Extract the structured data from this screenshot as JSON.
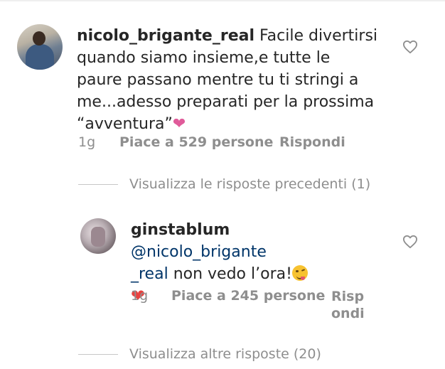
{
  "comment": {
    "username": "nicolo_brigante_real",
    "line1_text": "Facile divertirsi",
    "line2": "quando siamo insieme,e tutte le",
    "line3": "paure passano mentre tu ti stringi a",
    "line4": "me...adesso preparati per la prossima",
    "line5": "“avventura”",
    "heart": "❤",
    "time": "1g",
    "likes": "Piace a 529 persone",
    "reply": "Rispondi"
  },
  "view_previous": "Visualizza le risposte precedenti (1)",
  "reply_comment": {
    "username": "ginstablum",
    "mention_part1": "@nicolo_brigante",
    "mention_part2": "_real",
    "text": " non vedo l’ora!",
    "heart": "❤",
    "time": "1g",
    "likes": "Piace a 245 persone",
    "reply_line1": "Risp",
    "reply_line2": "ondi"
  },
  "view_more": "Visualizza altre risposte (20)",
  "colors": {
    "text": "#262626",
    "meta": "#8e8e8e",
    "mention": "#003569",
    "heart_pink": "#e05b9a",
    "heart_red": "#e8423f"
  }
}
